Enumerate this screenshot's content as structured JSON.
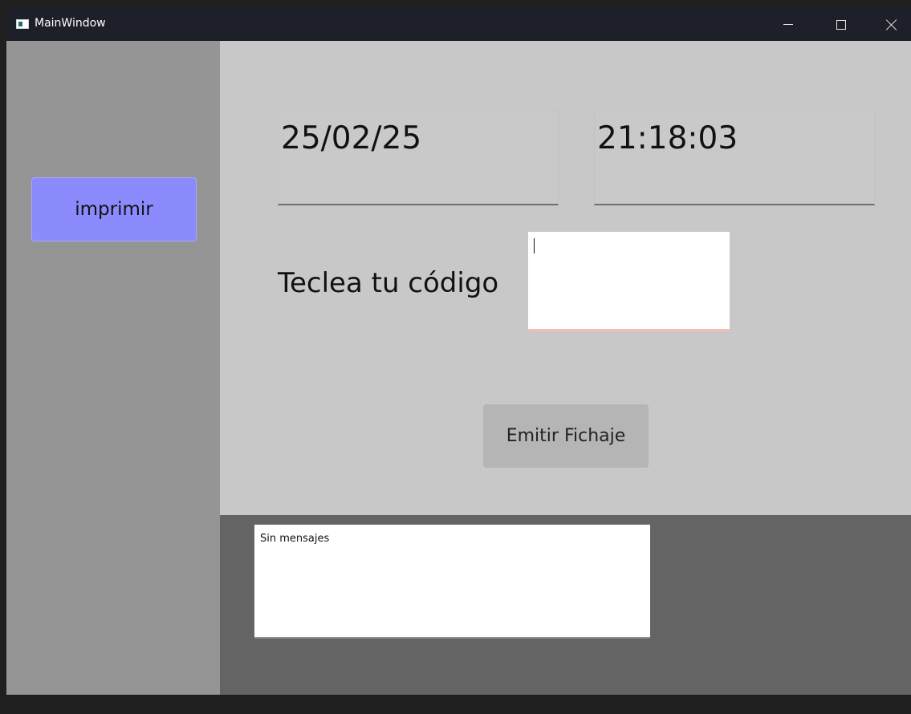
{
  "window": {
    "title": "MainWindow",
    "controls": {
      "minimize_icon": "minimize-icon",
      "maximize_icon": "maximize-icon",
      "close_icon": "close-icon"
    }
  },
  "sidebar": {
    "print_button_label": "imprimir",
    "print_button_color": "#8b8bfd"
  },
  "main": {
    "date_value": "25/02/25",
    "time_value": "21:18:03",
    "code_label": "Teclea tu código",
    "code_input_value": "",
    "emit_button_label": "Emitir Fichaje"
  },
  "messages": {
    "text": "Sin mensajes"
  }
}
